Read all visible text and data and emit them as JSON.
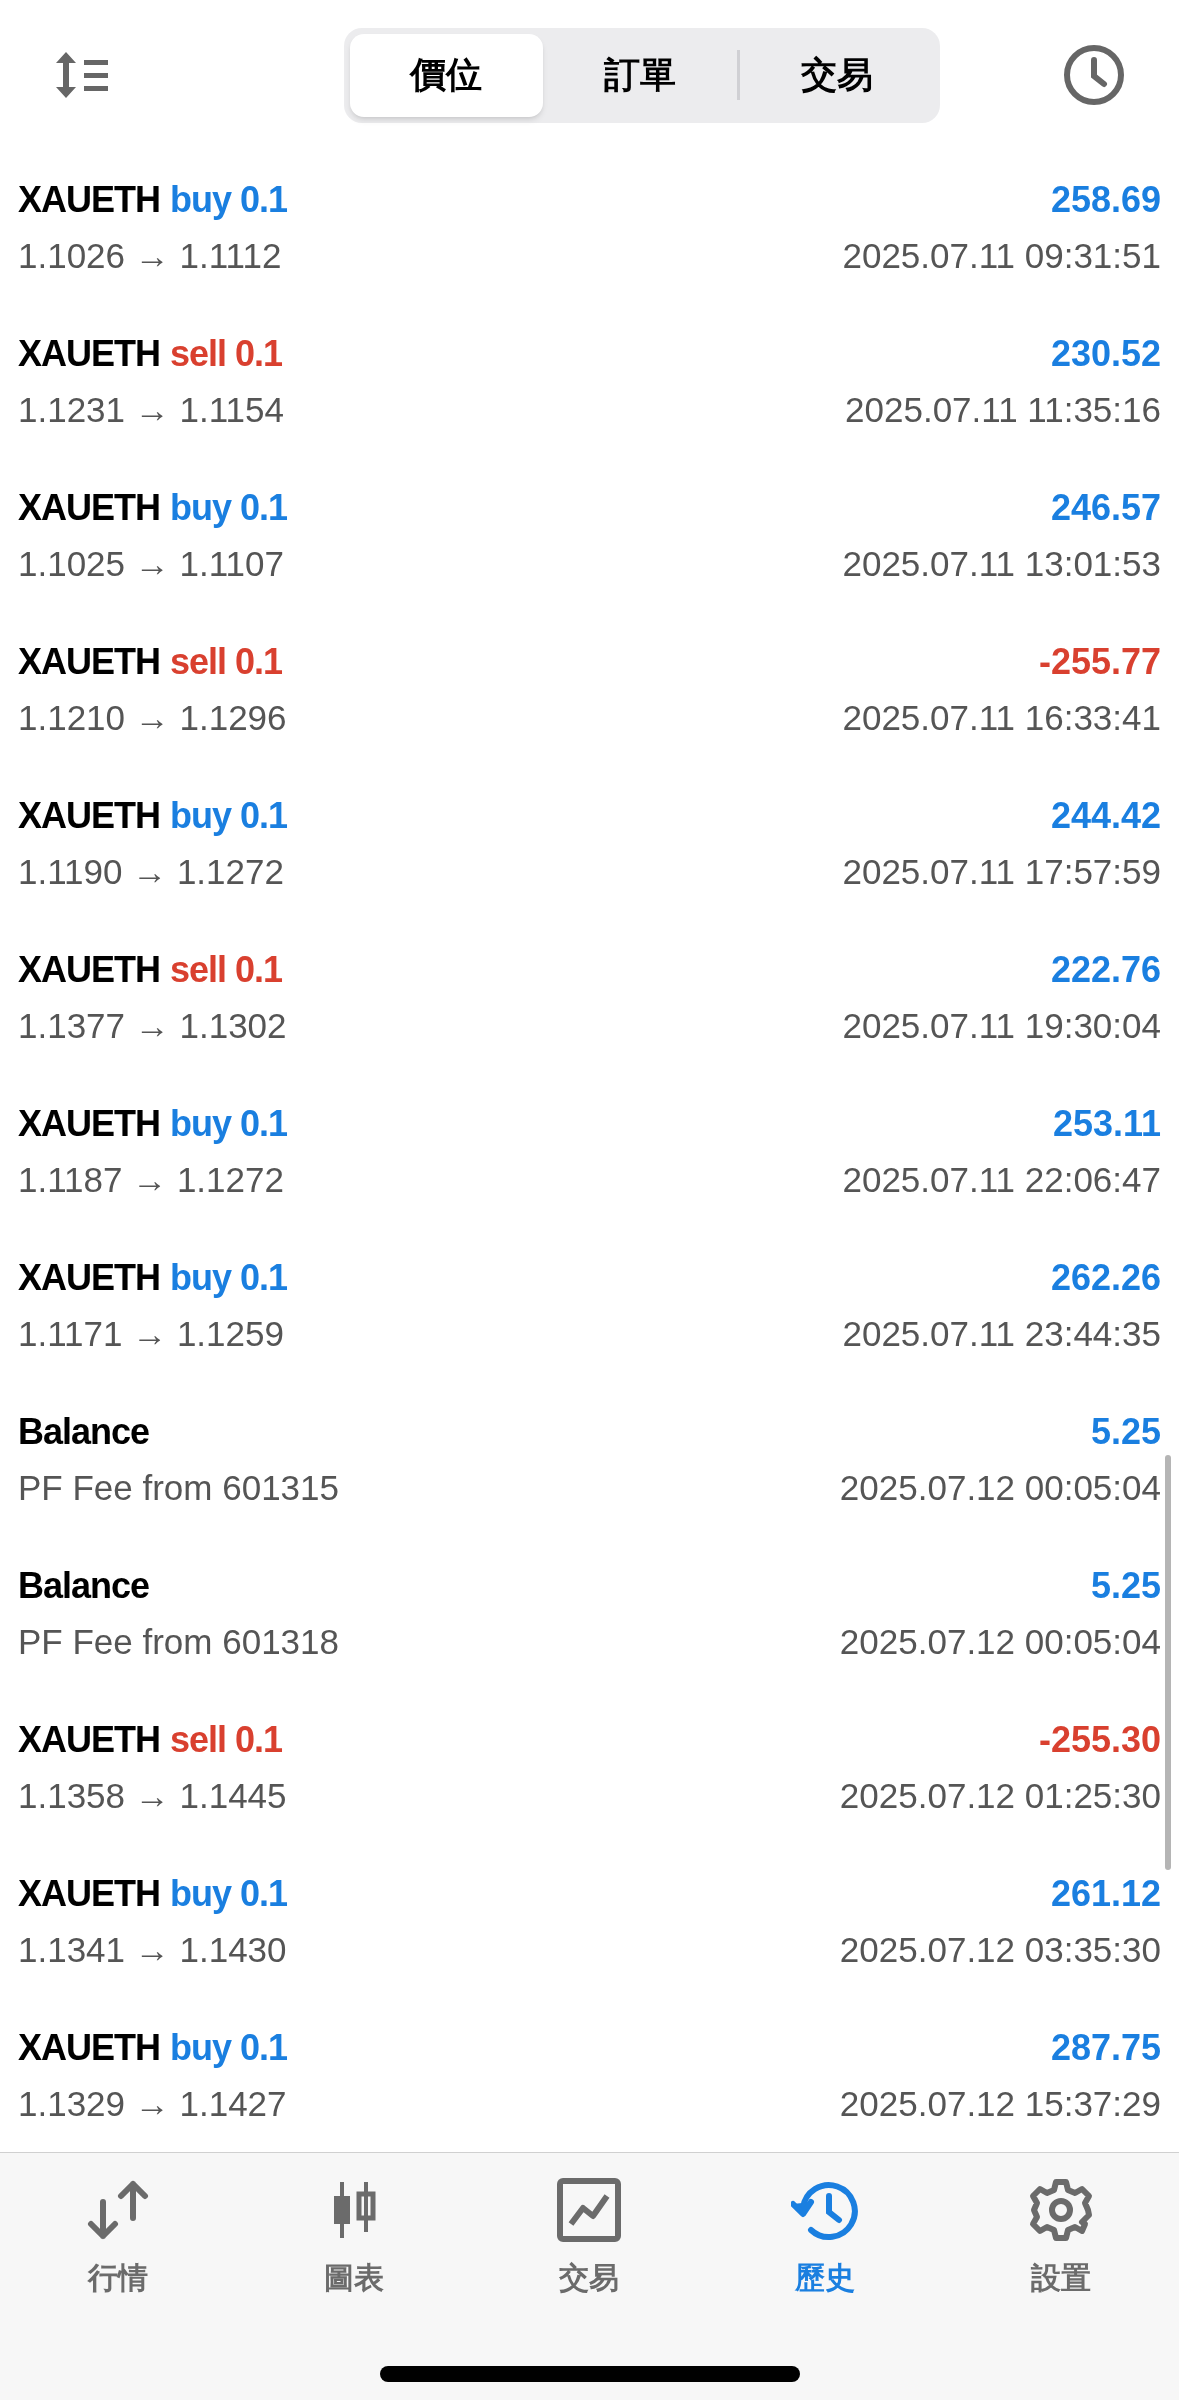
{
  "segments": [
    {
      "label": "價位",
      "selected": true
    },
    {
      "label": "訂單",
      "selected": false
    },
    {
      "label": "交易",
      "selected": false
    }
  ],
  "history": [
    {
      "kind": "trade",
      "symbol": "XAUETH",
      "side": "buy",
      "lots": "0.1",
      "amount": "258.69",
      "loss": false,
      "detail": "1.1026 → 1.1112",
      "time": "2025.07.11 09:31:51"
    },
    {
      "kind": "trade",
      "symbol": "XAUETH",
      "side": "sell",
      "lots": "0.1",
      "amount": "230.52",
      "loss": false,
      "detail": "1.1231 → 1.1154",
      "time": "2025.07.11 11:35:16"
    },
    {
      "kind": "trade",
      "symbol": "XAUETH",
      "side": "buy",
      "lots": "0.1",
      "amount": "246.57",
      "loss": false,
      "detail": "1.1025 → 1.1107",
      "time": "2025.07.11 13:01:53"
    },
    {
      "kind": "trade",
      "symbol": "XAUETH",
      "side": "sell",
      "lots": "0.1",
      "amount": "-255.77",
      "loss": true,
      "detail": "1.1210 → 1.1296",
      "time": "2025.07.11 16:33:41"
    },
    {
      "kind": "trade",
      "symbol": "XAUETH",
      "side": "buy",
      "lots": "0.1",
      "amount": "244.42",
      "loss": false,
      "detail": "1.1190 → 1.1272",
      "time": "2025.07.11 17:57:59"
    },
    {
      "kind": "trade",
      "symbol": "XAUETH",
      "side": "sell",
      "lots": "0.1",
      "amount": "222.76",
      "loss": false,
      "detail": "1.1377 → 1.1302",
      "time": "2025.07.11 19:30:04"
    },
    {
      "kind": "trade",
      "symbol": "XAUETH",
      "side": "buy",
      "lots": "0.1",
      "amount": "253.11",
      "loss": false,
      "detail": "1.1187 → 1.1272",
      "time": "2025.07.11 22:06:47"
    },
    {
      "kind": "trade",
      "symbol": "XAUETH",
      "side": "buy",
      "lots": "0.1",
      "amount": "262.26",
      "loss": false,
      "detail": "1.1171 → 1.1259",
      "time": "2025.07.11 23:44:35"
    },
    {
      "kind": "balance",
      "symbol": "Balance",
      "amount": "5.25",
      "loss": false,
      "detail": "PF Fee from 601315",
      "time": "2025.07.12 00:05:04"
    },
    {
      "kind": "balance",
      "symbol": "Balance",
      "amount": "5.25",
      "loss": false,
      "detail": "PF Fee from 601318",
      "time": "2025.07.12 00:05:04"
    },
    {
      "kind": "trade",
      "symbol": "XAUETH",
      "side": "sell",
      "lots": "0.1",
      "amount": "-255.30",
      "loss": true,
      "detail": "1.1358 → 1.1445",
      "time": "2025.07.12 01:25:30"
    },
    {
      "kind": "trade",
      "symbol": "XAUETH",
      "side": "buy",
      "lots": "0.1",
      "amount": "261.12",
      "loss": false,
      "detail": "1.1341 → 1.1430",
      "time": "2025.07.12 03:35:30"
    },
    {
      "kind": "trade",
      "symbol": "XAUETH",
      "side": "buy",
      "lots": "0.1",
      "amount": "287.75",
      "loss": false,
      "detail": "1.1329 → 1.1427",
      "time": "2025.07.12 15:37:29"
    }
  ],
  "nav": [
    {
      "label": "行情",
      "selected": false
    },
    {
      "label": "圖表",
      "selected": false
    },
    {
      "label": "交易",
      "selected": false
    },
    {
      "label": "歷史",
      "selected": true
    },
    {
      "label": "設置",
      "selected": false
    }
  ]
}
